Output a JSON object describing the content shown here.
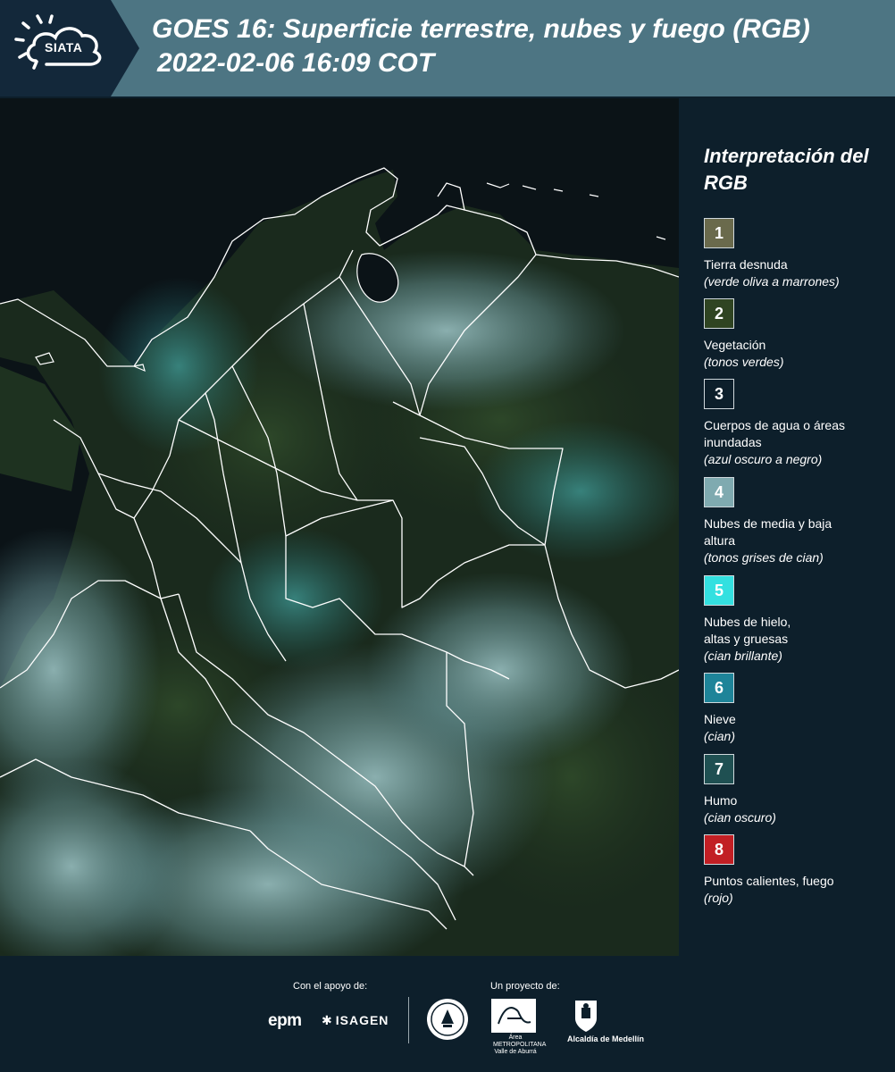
{
  "header": {
    "logo_text": "SIATA",
    "title_line1": "GOES 16: Superficie terrestre, nubes y fuego (RGB)",
    "title_line2": "2022-02-06 16:09 COT"
  },
  "legend": {
    "title": "Interpretación del RGB",
    "items": [
      {
        "number": "1",
        "label": "Tierra desnuda",
        "desc": "(verde oliva a marrones)",
        "color": "#6a6a4c"
      },
      {
        "number": "2",
        "label": "Vegetación",
        "desc": "(tonos verdes)",
        "color": "#2f4422"
      },
      {
        "number": "3",
        "label": "Cuerpos de agua o áreas inundadas",
        "desc": "(azul oscuro a negro)",
        "color": "#0d1f2b"
      },
      {
        "number": "4",
        "label": "Nubes de media y baja altura",
        "desc": "(tonos grises de cian)",
        "color": "#7faab0"
      },
      {
        "number": "5",
        "label": "Nubes de hielo, altas y gruesas",
        "desc": "(cian brillante)",
        "color": "#33e0e0"
      },
      {
        "number": "6",
        "label": "Nieve",
        "desc": "(cian)",
        "color": "#1e8499"
      },
      {
        "number": "7",
        "label": "Humo",
        "desc": "(cian oscuro)",
        "color": "#1f5052"
      },
      {
        "number": "8",
        "label": "Puntos calientes, fuego",
        "desc": "(rojo)",
        "color": "#c21f24"
      }
    ]
  },
  "footer": {
    "support_caption": "Con el apoyo de:",
    "project_caption": "Un proyecto de:",
    "sponsors": {
      "epm": "epm",
      "isagen": "ISAGEN",
      "amva": "Área METROPOLITANA Valle de Aburrá",
      "alcaldia": "Alcaldía de Medellín"
    }
  }
}
